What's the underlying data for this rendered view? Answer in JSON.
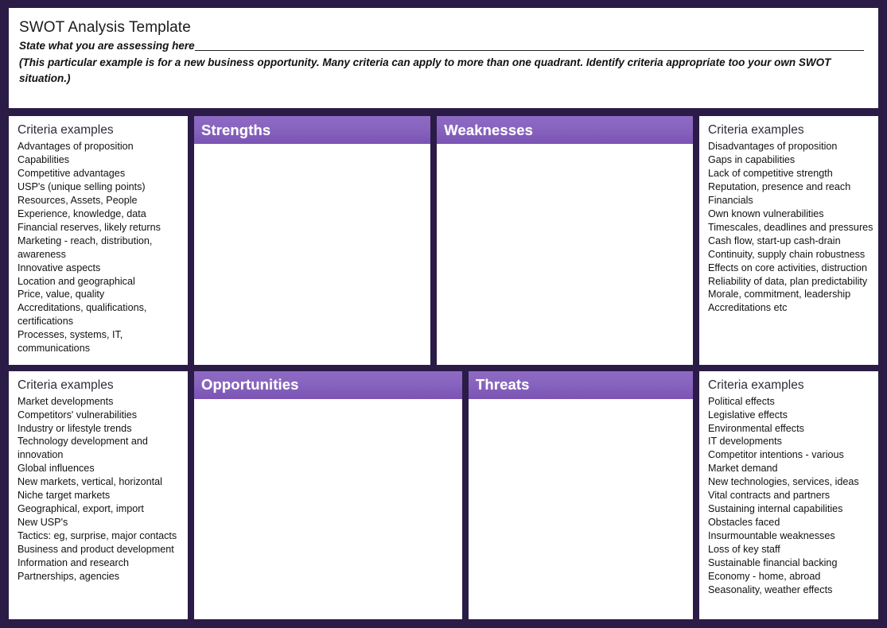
{
  "header": {
    "title": "SWOT Analysis Template",
    "assess_label": "State what you are assessing here",
    "note": "(This particular example is for a new business opportunity. Many criteria can apply to more than one quadrant. Identify criteria appropriate too your own SWOT situation.)"
  },
  "colors": {
    "frame": "#2b1b47",
    "quadrant_header_top": "#8e6ac4",
    "quadrant_header_bottom": "#7b53b4",
    "paper": "#ffffff"
  },
  "criteria_title": "Criteria examples",
  "quadrants": {
    "strengths": {
      "label": "Strengths"
    },
    "weaknesses": {
      "label": "Weaknesses"
    },
    "opportunities": {
      "label": "Opportunities"
    },
    "threats": {
      "label": "Threats"
    }
  },
  "criteria": {
    "strengths": {
      "title": "Criteria examples",
      "items": [
        "Advantages of proposition",
        "Capabilities",
        "Competitive advantages",
        "USP's (unique selling points)",
        "Resources, Assets, People",
        "Experience, knowledge, data",
        "Financial reserves, likely returns",
        "Marketing -  reach, distribution, awareness",
        "Innovative aspects",
        "Location and geographical",
        "Price, value, quality",
        "Accreditations, qualifications, certifications",
        "Processes, systems, IT, communications"
      ]
    },
    "weaknesses": {
      "title": "Criteria examples",
      "items": [
        "Disadvantages of proposition",
        "Gaps in capabilities",
        "Lack of competitive strength",
        "Reputation, presence and reach",
        "Financials",
        "Own known vulnerabilities",
        "Timescales, deadlines and pressures",
        "Cash flow, start-up cash-drain",
        "Continuity, supply chain robustness",
        "Effects on core activities, distruction",
        "Reliability of data, plan predictability",
        "Morale, commitment, leadership",
        "Accreditations etc"
      ]
    },
    "opportunities": {
      "title": "Criteria examples",
      "items": [
        "Market developments",
        "Competitors' vulnerabilities",
        "Industry or lifestyle trends",
        "Technology development and innovation",
        "Global influences",
        "New markets, vertical, horizontal",
        "Niche target markets",
        "Geographical, export, import",
        "New USP's",
        "Tactics: eg, surprise, major contacts",
        "Business and product development",
        "Information and research",
        "Partnerships, agencies"
      ]
    },
    "threats": {
      "title": "Criteria examples",
      "items": [
        "Political effects",
        "Legislative effects",
        "Environmental effects",
        "IT developments",
        "Competitor intentions - various",
        "Market demand",
        "New technologies, services, ideas",
        "Vital contracts and partners",
        "Sustaining internal capabilities",
        "Obstacles faced",
        "Insurmountable weaknesses",
        "Loss of key staff",
        "Sustainable financial backing",
        "Economy - home, abroad",
        "Seasonality, weather effects"
      ]
    }
  }
}
